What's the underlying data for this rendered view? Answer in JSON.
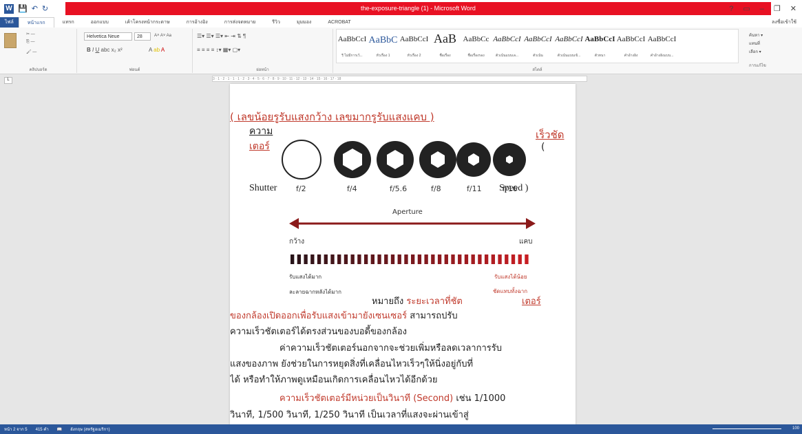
{
  "window": {
    "title": "the-exposure-triangle (1) - Microsoft Word",
    "help": "?",
    "minimize": "–",
    "restore": "❐",
    "close": "✕"
  },
  "tabs": [
    "ไฟล์",
    "หน้าแรก",
    "แทรก",
    "ออกแบบ",
    "เค้าโครงหน้ากระดาษ",
    "การอ้างอิง",
    "การส่งจดหมาย",
    "รีวิว",
    "มุมมอง",
    "ACROBAT"
  ],
  "user": "ลงชื่อเข้าใช้",
  "ribbon": {
    "font_name": "Helvetica Neue",
    "font_size": "28",
    "groups": [
      "คลิปบอร์ด",
      "ฟอนต์",
      "ย่อหน้า",
      "สไตล์",
      "การแก้ไข"
    ],
    "styles": [
      {
        "preview": "AaBbCcI",
        "name": "¶ ไม่มีการเว้..."
      },
      {
        "preview": "AaBbC",
        "name": "หัวเรื่อง 1"
      },
      {
        "preview": "AaBbCcI",
        "name": "หัวเรื่อง 2"
      },
      {
        "preview": "AaB",
        "name": "ชื่อเรื่อง"
      },
      {
        "preview": "AaBbCc",
        "name": "ชื่อเรื่องรอง"
      },
      {
        "preview": "AaBbCcI",
        "name": "ตัวเน้นแบบเล..."
      },
      {
        "preview": "AaBbCcI",
        "name": "ตัวเน้น"
      },
      {
        "preview": "AaBbCcI",
        "name": "ตัวเน้นแบบเข้..."
      },
      {
        "preview": "AaBbCcI",
        "name": "ตัวหนา"
      },
      {
        "preview": "AaBbCcI",
        "name": "คำอ้างอิง"
      },
      {
        "preview": "AaBbCcI",
        "name": "คำอ้างอิงแบบ..."
      }
    ],
    "editing": [
      "ค้นหา ▾",
      "แทนที่",
      "เลือก ▾"
    ]
  },
  "ruler": "3 · 1 · 2 · 1 · 1 · 1 · 2 · 3 · 4 · 5 · 6 · 7 · 8 · 9 · 10 · 11 · 12 · 13 · 14 · 15 · 16 · 17 · 18",
  "doc": {
    "line1": "( เลขน้อยรูรับแสงกว้าง เลขมากรูรับแสงแคบ )",
    "shutter_th_1": "ความ",
    "shutter_th_2": "เตอร์",
    "speed_th": "เร็วชัด",
    "open_paren": "(",
    "shutter_en": "Shutter",
    "speed_en": "Speed )",
    "fstops": [
      "f/2",
      "f/4",
      "f/5.6",
      "f/8",
      "f/11",
      "f/16"
    ],
    "aperture_label": "Aperture",
    "wide": "กว้าง",
    "narrow": "แคบ",
    "more_light_1": "รับแสงได้มาก",
    "more_light_2": "ละลายฉากหลังได้มาก",
    "less_light_1": "รับแสงได้น้อย",
    "less_light_2": "ชัดแทบทั้งฉาก",
    "p1_a": "หมายถึง ",
    "p1_b": "ระยะเวลาที่ชัต",
    "p1_c": "เตอร์",
    "p2_a": "ของกล้องเปิดออกเพื่อรับแสงเข้ามายังเซนเซอร์",
    "p2_b": " สามารถปรับ",
    "p3": "ความเร็วชัตเตอร์ได้ตรงส่วนของบอดี้ของกล้อง",
    "p4": "ค่าความเร็วชัตเตอร์นอกจากจะช่วยเพิ่มหรือลดเวลาการรับ",
    "p5": "แสงของภาพ ยังช่วยในการหยุดสิ่งที่เคลื่อนไหวเร็วๆให้นิ่งอยู่กับที่",
    "p6": "ได้ หรือทำให้ภาพดูเหมือนเกิดการเคลื่อนไหวได้อีกด้วย",
    "p7_a": "ความเร็วชัตเตอร์มีหน่วยเป็นวินาที (Second)",
    "p7_b": " เช่น 1/1000",
    "p8": "วินาที, 1/500 วินาที, 1/250 วินาที เป็นเวลาที่แสงจะผ่านเข้าสู่"
  },
  "status": {
    "page": "หน้า 2 จาก 5",
    "words": "415 คำ",
    "lang": "อังกฤษ (สหรัฐอเมริกา)",
    "zoom": "100"
  },
  "colors": {
    "accent": "#2b579a",
    "title_red": "#e81123",
    "doc_red": "#c0392b",
    "arrow": "#8b1a1a"
  }
}
